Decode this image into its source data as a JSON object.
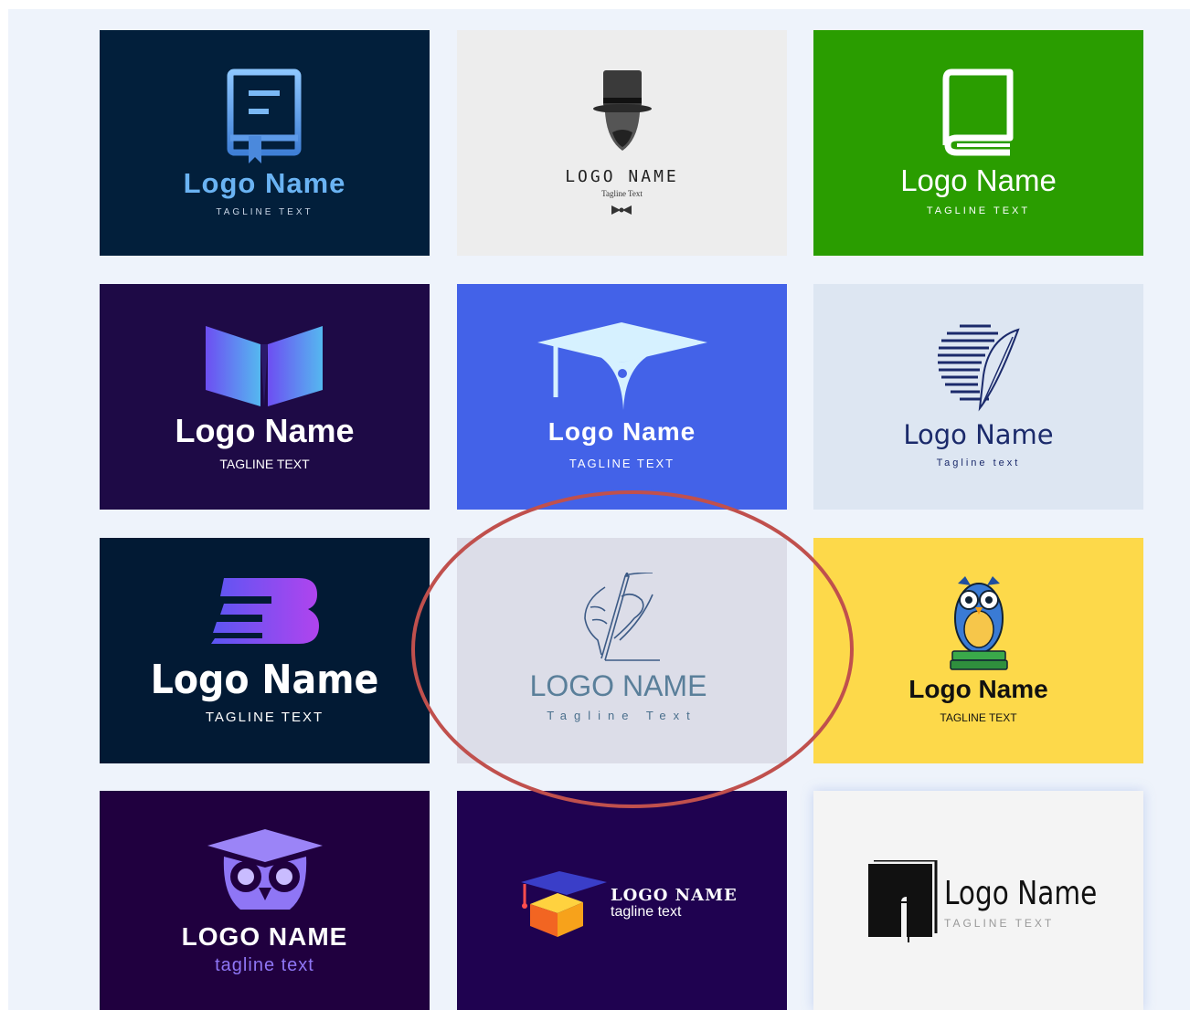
{
  "gallery": {
    "cards": [
      {
        "id": "book-doc",
        "name": "Logo Name",
        "tagline": "TAGLINE TEXT",
        "bg": "#021f3b",
        "accent": "#6ab3f3"
      },
      {
        "id": "top-hat",
        "name": "LOGO NAME",
        "tagline": "Tagline Text",
        "bg": "#ededed",
        "accent": "#333333"
      },
      {
        "id": "green-book",
        "name": "Logo Name",
        "tagline": "TAGLINE TEXT",
        "bg": "#2a9d00",
        "accent": "#ffffff"
      },
      {
        "id": "open-book",
        "name": "Logo Name",
        "tagline": "TAGLINE TEXT",
        "bg": "#1e0a46",
        "accent": "#5d6af0"
      },
      {
        "id": "grad-cap-blue",
        "name": "Logo Name",
        "tagline": "TAGLINE TEXT",
        "bg": "#4362e8",
        "accent": "#d6f1ff"
      },
      {
        "id": "feather-circle",
        "name": "Logo Name",
        "tagline": "Tagline text",
        "bg": "#dde6f2",
        "accent": "#1b2a6b"
      },
      {
        "id": "speed-b",
        "name": "Logo Name",
        "tagline": "TAGLINE TEXT",
        "bg": "#021a34",
        "accent": "#8a4bf0"
      },
      {
        "id": "hand-pen",
        "name": "LOGO NAME",
        "tagline": "Tagline  Text",
        "bg": "#dcdde8",
        "accent": "#5a7f9a"
      },
      {
        "id": "owl-books",
        "name": "Logo Name",
        "tagline": "TAGLINE TEXT",
        "bg": "#fdd94a",
        "accent": "#111111"
      },
      {
        "id": "owl-cap",
        "name": "LOGO NAME",
        "tagline": "tagline text",
        "bg": "#20003f",
        "accent": "#8f76f5"
      },
      {
        "id": "cube-cap",
        "name": "LOGO NAME",
        "tagline": "tagline text",
        "bg": "#1f0250",
        "accent": "#ffffff"
      },
      {
        "id": "door-book",
        "name": "Logo Name",
        "tagline": "TAGLINE TEXT",
        "bg": "#f4f4f4",
        "accent": "#111111"
      }
    ]
  },
  "annotation": {
    "color": "#c0504d",
    "shape": "ellipse",
    "target": "hand-pen"
  }
}
